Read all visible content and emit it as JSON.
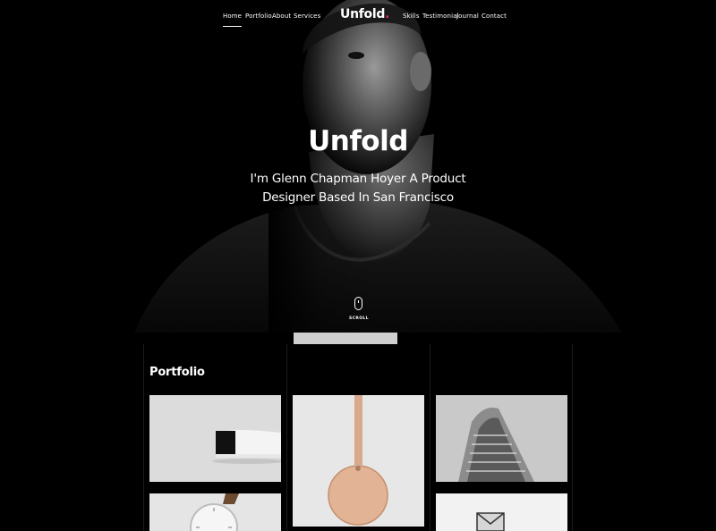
{
  "nav": {
    "items_left": [
      "Home",
      "Portfolio",
      "About",
      "Services"
    ],
    "logo": "Unfold",
    "logo_dot": ".",
    "items_right": [
      "Skills",
      "Testimonial",
      "Journal",
      "Contact"
    ],
    "active": "Home"
  },
  "hero": {
    "title": "Unfold",
    "subtitle": "I'm Glenn Chapman Hoyer A Product Designer Based In San Francisco",
    "scroll_label": "SCROLL"
  },
  "portfolio": {
    "title": "Portfolio",
    "items": [
      {
        "subject": "sneaker"
      },
      {
        "subject": "leather-tag"
      },
      {
        "subject": "architecture"
      },
      {
        "subject": "watch"
      },
      {
        "subject": "envelope"
      }
    ]
  },
  "colors": {
    "background": "#000000",
    "text": "#ffffff",
    "accent": "#e0245e"
  }
}
